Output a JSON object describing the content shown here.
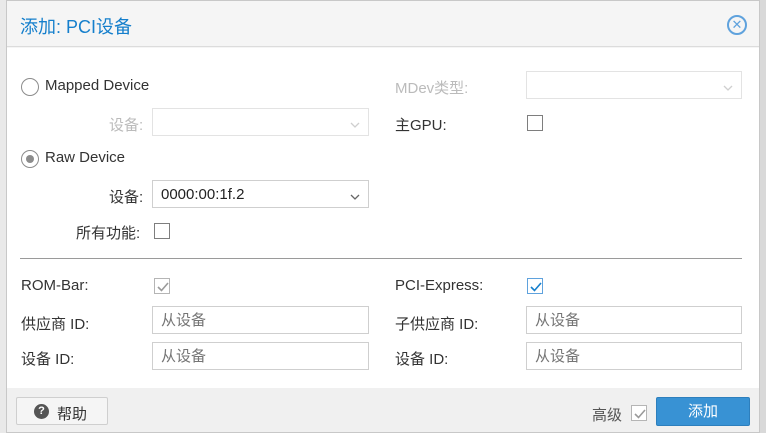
{
  "dialog": {
    "title": "添加: PCI设备"
  },
  "form": {
    "mapped_device_label": "Mapped Device",
    "mapped_device_field_label": "设备:",
    "mdev_type_label": "MDev类型:",
    "primary_gpu_label": "主GPU:",
    "raw_device_label": "Raw Device",
    "raw_device_field_label": "设备:",
    "raw_device_value": "0000:00:1f.2",
    "all_functions_label": "所有功能:",
    "rom_bar_label": "ROM-Bar:",
    "pci_express_label": "PCI-Express:",
    "vendor_id_label": "供应商 ID:",
    "vendor_id_placeholder": "从设备",
    "sub_vendor_id_label": "子供应商 ID:",
    "sub_vendor_id_placeholder": "从设备",
    "device_id_label": "设备 ID:",
    "device_id_placeholder": "从设备",
    "sub_device_id_label": "设备 ID:",
    "sub_device_id_placeholder": "从设备"
  },
  "state": {
    "selected_mode": "Raw Device",
    "rom_bar_checked": true,
    "pci_express_checked": true,
    "primary_gpu_checked": false,
    "all_functions_checked": false,
    "advanced_checked": true
  },
  "footer": {
    "help_label": "帮助",
    "advanced_label": "高级",
    "add_label": "添加"
  },
  "colors": {
    "accent": "#157fcc",
    "primary_button": "#3892d4",
    "check_disabled": "#9a9a9a"
  }
}
